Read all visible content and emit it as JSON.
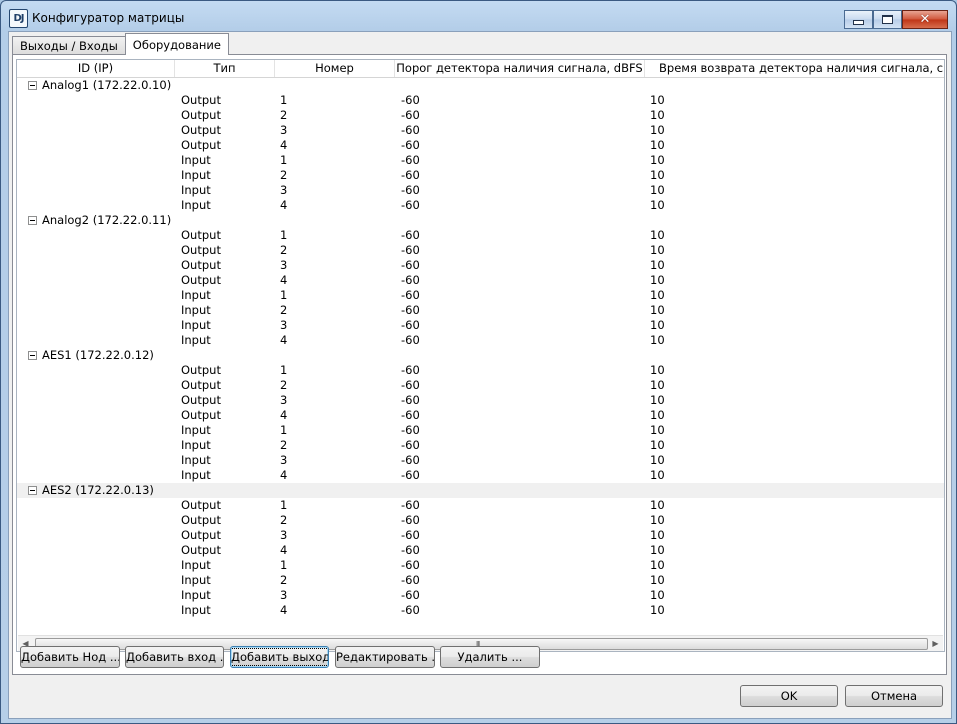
{
  "window": {
    "title": "Конфигуратор матрицы",
    "app_icon_text": "DJ"
  },
  "tabs": [
    {
      "label": "Выходы / Входы",
      "active": false
    },
    {
      "label": "Оборудование",
      "active": true
    }
  ],
  "table": {
    "columns": [
      "ID (IP)",
      "Тип",
      "Номер",
      "Порог детектора наличия сигнала, dBFS",
      "Время возврата детектора наличия сигнала, с"
    ],
    "groups": [
      {
        "label": "Analog1 (172.22.0.10)",
        "rows": [
          {
            "type": "Output",
            "num": "1",
            "thr": "-60",
            "ret": "10"
          },
          {
            "type": "Output",
            "num": "2",
            "thr": "-60",
            "ret": "10"
          },
          {
            "type": "Output",
            "num": "3",
            "thr": "-60",
            "ret": "10"
          },
          {
            "type": "Output",
            "num": "4",
            "thr": "-60",
            "ret": "10"
          },
          {
            "type": "Input",
            "num": "1",
            "thr": "-60",
            "ret": "10"
          },
          {
            "type": "Input",
            "num": "2",
            "thr": "-60",
            "ret": "10"
          },
          {
            "type": "Input",
            "num": "3",
            "thr": "-60",
            "ret": "10"
          },
          {
            "type": "Input",
            "num": "4",
            "thr": "-60",
            "ret": "10"
          }
        ]
      },
      {
        "label": "Analog2 (172.22.0.11)",
        "rows": [
          {
            "type": "Output",
            "num": "1",
            "thr": "-60",
            "ret": "10"
          },
          {
            "type": "Output",
            "num": "2",
            "thr": "-60",
            "ret": "10"
          },
          {
            "type": "Output",
            "num": "3",
            "thr": "-60",
            "ret": "10"
          },
          {
            "type": "Output",
            "num": "4",
            "thr": "-60",
            "ret": "10"
          },
          {
            "type": "Input",
            "num": "1",
            "thr": "-60",
            "ret": "10"
          },
          {
            "type": "Input",
            "num": "2",
            "thr": "-60",
            "ret": "10"
          },
          {
            "type": "Input",
            "num": "3",
            "thr": "-60",
            "ret": "10"
          },
          {
            "type": "Input",
            "num": "4",
            "thr": "-60",
            "ret": "10"
          }
        ]
      },
      {
        "label": "AES1 (172.22.0.12)",
        "rows": [
          {
            "type": "Output",
            "num": "1",
            "thr": "-60",
            "ret": "10"
          },
          {
            "type": "Output",
            "num": "2",
            "thr": "-60",
            "ret": "10"
          },
          {
            "type": "Output",
            "num": "3",
            "thr": "-60",
            "ret": "10"
          },
          {
            "type": "Output",
            "num": "4",
            "thr": "-60",
            "ret": "10"
          },
          {
            "type": "Input",
            "num": "1",
            "thr": "-60",
            "ret": "10"
          },
          {
            "type": "Input",
            "num": "2",
            "thr": "-60",
            "ret": "10"
          },
          {
            "type": "Input",
            "num": "3",
            "thr": "-60",
            "ret": "10"
          },
          {
            "type": "Input",
            "num": "4",
            "thr": "-60",
            "ret": "10"
          }
        ]
      },
      {
        "label": "AES2 (172.22.0.13)",
        "rows": [
          {
            "type": "Output",
            "num": "1",
            "thr": "-60",
            "ret": "10"
          },
          {
            "type": "Output",
            "num": "2",
            "thr": "-60",
            "ret": "10"
          },
          {
            "type": "Output",
            "num": "3",
            "thr": "-60",
            "ret": "10"
          },
          {
            "type": "Output",
            "num": "4",
            "thr": "-60",
            "ret": "10"
          },
          {
            "type": "Input",
            "num": "1",
            "thr": "-60",
            "ret": "10"
          },
          {
            "type": "Input",
            "num": "2",
            "thr": "-60",
            "ret": "10"
          },
          {
            "type": "Input",
            "num": "3",
            "thr": "-60",
            "ret": "10"
          },
          {
            "type": "Input",
            "num": "4",
            "thr": "-60",
            "ret": "10"
          }
        ]
      }
    ],
    "highlighted_row": "AES2 (172.22.0.13)"
  },
  "scrollbar": {
    "grip": "III"
  },
  "actions": {
    "add_node": "Добавить Нод ...",
    "add_input": "Добавить вход ...",
    "add_output": "Добавить выход ...",
    "edit": "Редактировать ...",
    "delete": "Удалить ..."
  },
  "dialog": {
    "ok": "OK",
    "cancel": "Отмена"
  }
}
